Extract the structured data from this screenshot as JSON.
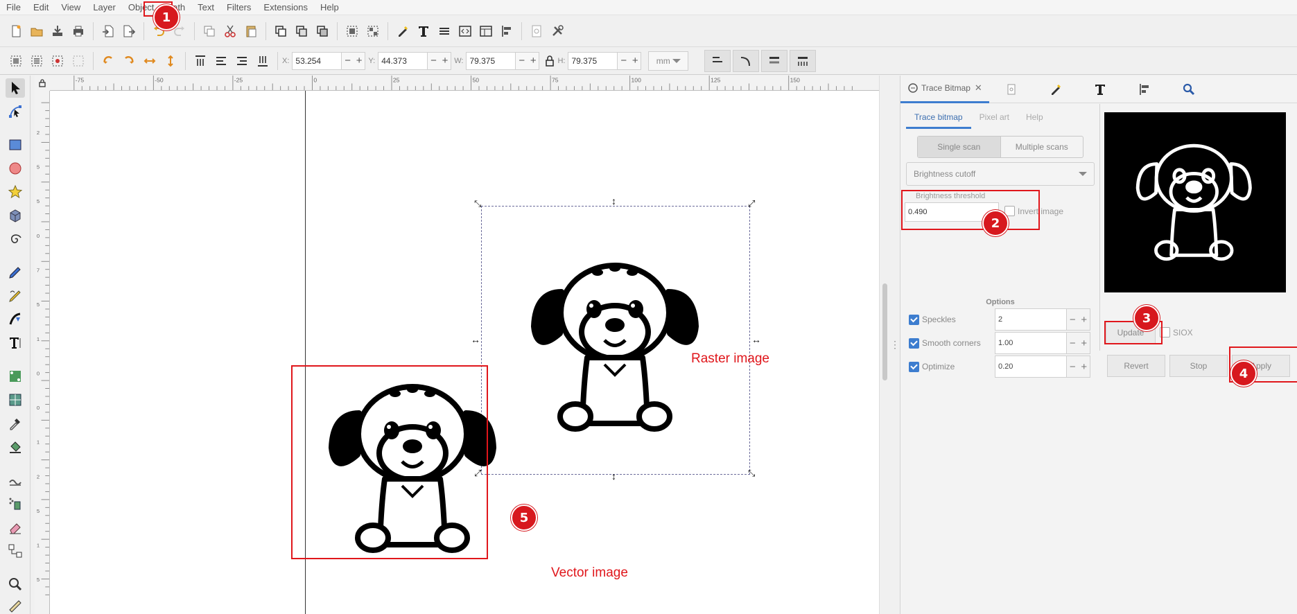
{
  "menu": [
    "File",
    "Edit",
    "View",
    "Layer",
    "Object",
    "Path",
    "Text",
    "Filters",
    "Extensions",
    "Help"
  ],
  "toolbar": {
    "x_label": "X:",
    "x_value": "53.254",
    "y_label": "Y:",
    "y_value": "44.373",
    "w_label": "W:",
    "w_value": "79.375",
    "h_label": "H:",
    "h_value": "79.375",
    "unit": "mm"
  },
  "ruler": {
    "top_labels": [
      "-75",
      "-50",
      "-25",
      "0",
      "25",
      "50",
      "75",
      "100",
      "125",
      "150"
    ],
    "left_labels": [
      "2",
      "5",
      "5",
      "0",
      "7",
      "5",
      "1",
      "0",
      "0",
      "1",
      "2",
      "5",
      "1",
      "5"
    ]
  },
  "canvas": {
    "raster_label": "Raster image",
    "vector_label": "Vector image"
  },
  "dock": {
    "tab_title": "Trace Bitmap",
    "tab_close": "✕",
    "subtabs": [
      "Trace bitmap",
      "Pixel art",
      "Help"
    ],
    "scan_modes": [
      "Single scan",
      "Multiple scans"
    ],
    "mode": "Brightness cutoff",
    "threshold_label": "Brightness threshold",
    "threshold_value": "0.490",
    "invert_label": "Invert image",
    "options_title": "Options",
    "options": [
      {
        "label": "Speckles",
        "value": "2",
        "checked": true
      },
      {
        "label": "Smooth corners",
        "value": "1.00",
        "checked": true
      },
      {
        "label": "Optimize",
        "value": "0.20",
        "checked": true
      }
    ],
    "update_label": "Update",
    "siox_label": "SIOX",
    "revert_label": "Revert",
    "stop_label": "Stop",
    "apply_label": "Apply"
  },
  "badges": [
    "1",
    "2",
    "3",
    "4",
    "5"
  ],
  "colors": {
    "accent": "#3d7dcf",
    "annotation": "#e0161b"
  }
}
